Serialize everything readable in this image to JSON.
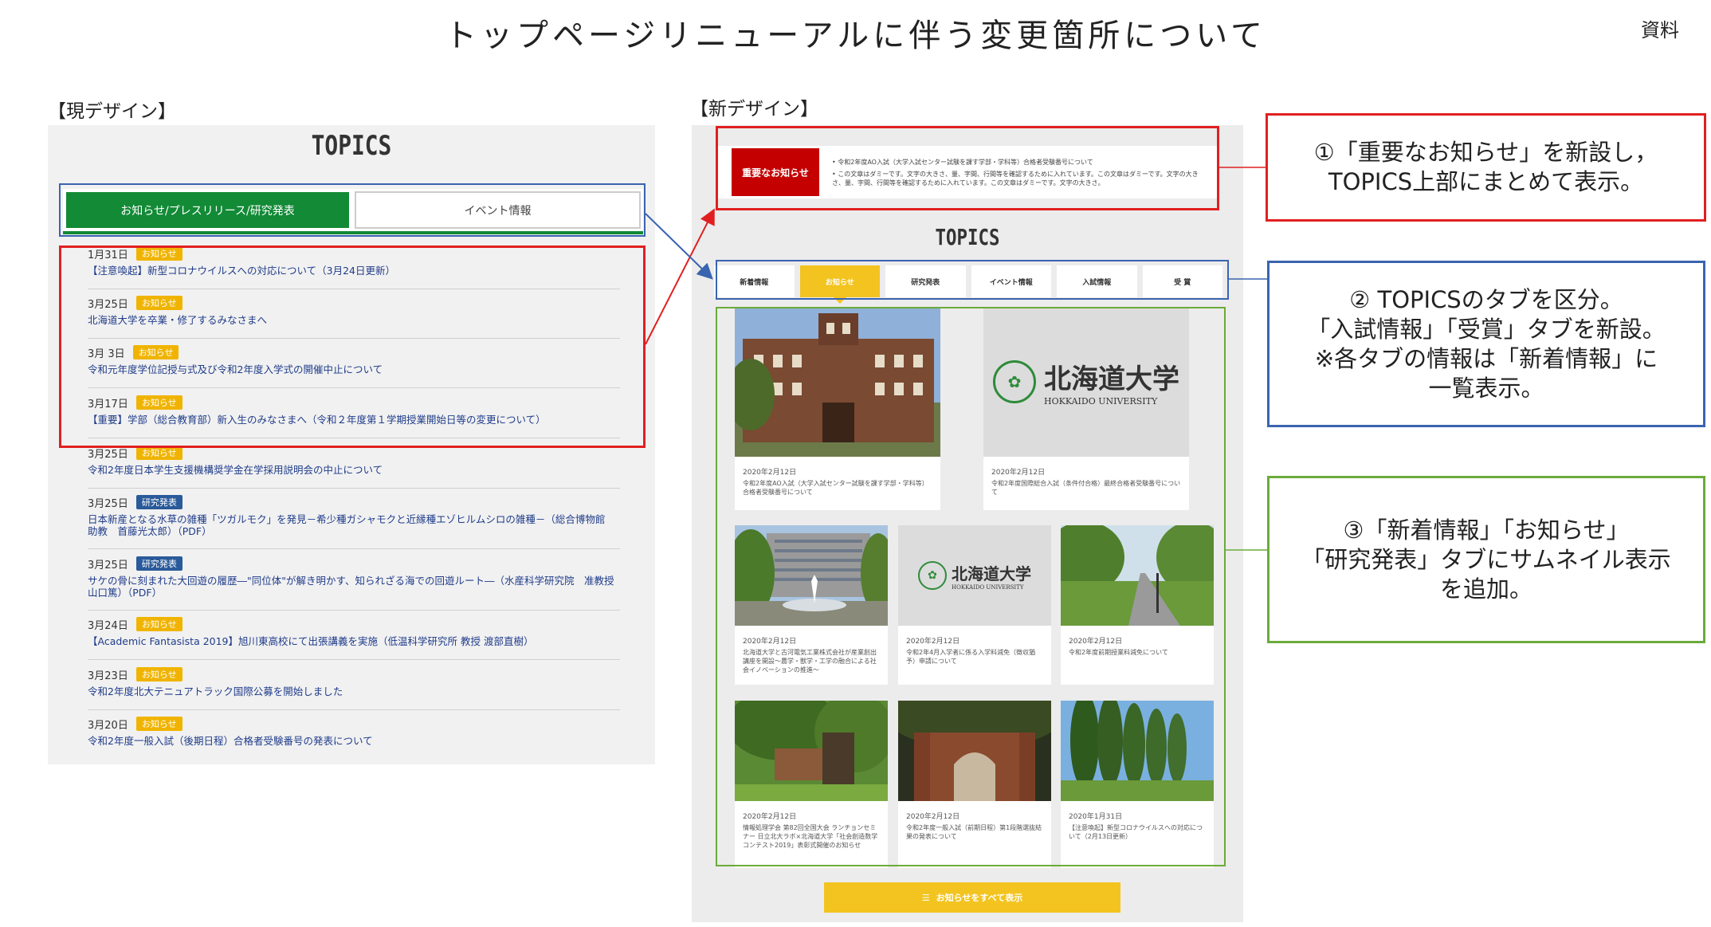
{
  "page": {
    "title": "トップページリニューアルに伴う変更箇所について",
    "doc_label": "資料"
  },
  "current": {
    "label": "【現デザイン】",
    "topics_title": "TOPICS",
    "tabs": [
      "お知らせ/プレスリリース/研究発表",
      "イベント情報"
    ],
    "items": [
      {
        "date": "1月31日",
        "badge": "お知らせ",
        "text": "【注意喚起】新型コロナウイルスへの対応について（3月24日更新）"
      },
      {
        "date": "3月25日",
        "badge": "お知らせ",
        "text": "北海道大学を卒業・修了するみなさまへ"
      },
      {
        "date": "3月 3日",
        "badge": "お知らせ",
        "text": "令和元年度学位記授与式及び令和2年度入学式の開催中止について"
      },
      {
        "date": "3月17日",
        "badge": "お知らせ",
        "text": "【重要】学部（総合教育部）新入生のみなさまへ（令和２年度第１学期授業開始日等の変更について）"
      },
      {
        "date": "3月25日",
        "badge": "お知らせ",
        "text": "令和2年度日本学生支援機構奨学金在学採用説明会の中止について"
      },
      {
        "date": "3月25日",
        "badge": "研究発表",
        "text": "日本新産となる水草の雑種「ツガルモク」を発見－希少種ガシャモクと近縁種エゾヒルムシロの雑種－（総合博物館　助教　首藤光太郎）（PDF）"
      },
      {
        "date": "3月25日",
        "badge": "研究発表",
        "text": "サケの骨に刻まれた大回遊の履歴―\"同位体\"が解き明かす、知られざる海での回遊ルート―（水産科学研究院　准教授　山口篤）（PDF）"
      },
      {
        "date": "3月24日",
        "badge": "お知らせ",
        "text": "【Academic Fantasista 2019】旭川東高校にて出張講義を実施（低温科学研究所 教授 渡部直樹）"
      },
      {
        "date": "3月23日",
        "badge": "お知らせ",
        "text": "令和2年度北大テニュアトラック国際公募を開始しました"
      },
      {
        "date": "3月20日",
        "badge": "お知らせ",
        "text": "令和2年度一般入試（後期日程）合格者受験番号の発表について"
      }
    ]
  },
  "new_design": {
    "label": "【新デザイン】",
    "important_label": "重要なお知らせ",
    "important_items": [
      "令和2年度AO入試（大学入試センター試験を課す学部・学科等）合格者受験番号について",
      "この文章はダミーです。文字の大きさ、量、字間、行間等を確認するために入れています。この文章はダミーです。文字の大きさ、量、字間、行間等を確認するために入れています。この文章はダミーです。文字の大きさ。"
    ],
    "topics_title": "TOPICS",
    "tabs": [
      "新着情報",
      "お知らせ",
      "研究発表",
      "イベント情報",
      "入試情報",
      "受 賞"
    ],
    "active_tab": "お知らせ",
    "logo": {
      "jp": "北海道大学",
      "en": "HOKKAIDO UNIVERSITY"
    },
    "cards": [
      {
        "date": "2020年2月12日",
        "text": "令和2年度AO入試（大学入試センター試験を課す学部・学科等）合格者受験番号について"
      },
      {
        "date": "2020年2月12日",
        "text": "令和2年度国際総合入試（条件付合格）最終合格者受験番号について"
      },
      {
        "date": "2020年2月12日",
        "text": "北海道大学と古河電気工業株式会社が産業創出講座を開設～農学・獣学・工学の融合による社会イノベーションの推進～"
      },
      {
        "date": "2020年2月12日",
        "text": "令和2年4月入学者に係る入学料減免（徴収猶予）申請について"
      },
      {
        "date": "2020年2月12日",
        "text": "令和2年度前期授業料減免について"
      },
      {
        "date": "2020年2月12日",
        "text": "情報処理学会 第82回全国大会 ランチョンセミナー 日立北大ラボ×北海道大学「社会創造数学コンテスト2019」表彰式開催のお知らせ"
      },
      {
        "date": "2020年2月12日",
        "text": "令和2年度一般入試（前期日程）第1段階選抜結果の発表について"
      },
      {
        "date": "2020年1月31日",
        "text": "【注意喚起】新型コロナウイルスへの対応について（2月13日更新）"
      }
    ],
    "more_button": "お知らせをすべて表示"
  },
  "annotations": [
    [
      "①「重要なお知らせ」を新設し，",
      "TOPICS上部にまとめて表示。"
    ],
    [
      "② TOPICSのタブを区分。",
      "「入試情報」「受賞」タブを新設。",
      "※各タブの情報は「新着情報」に",
      "一覧表示。"
    ],
    [
      "③「新着情報」「お知らせ」",
      "「研究発表」タブにサムネイル表示",
      "を追加。"
    ]
  ],
  "colors": {
    "green": "#128a36",
    "yellow": "#f3c420",
    "red_frame": "#e02020",
    "blue_frame": "#3a64b0",
    "green_frame": "#6aab3a",
    "important_red": "#c40000"
  }
}
